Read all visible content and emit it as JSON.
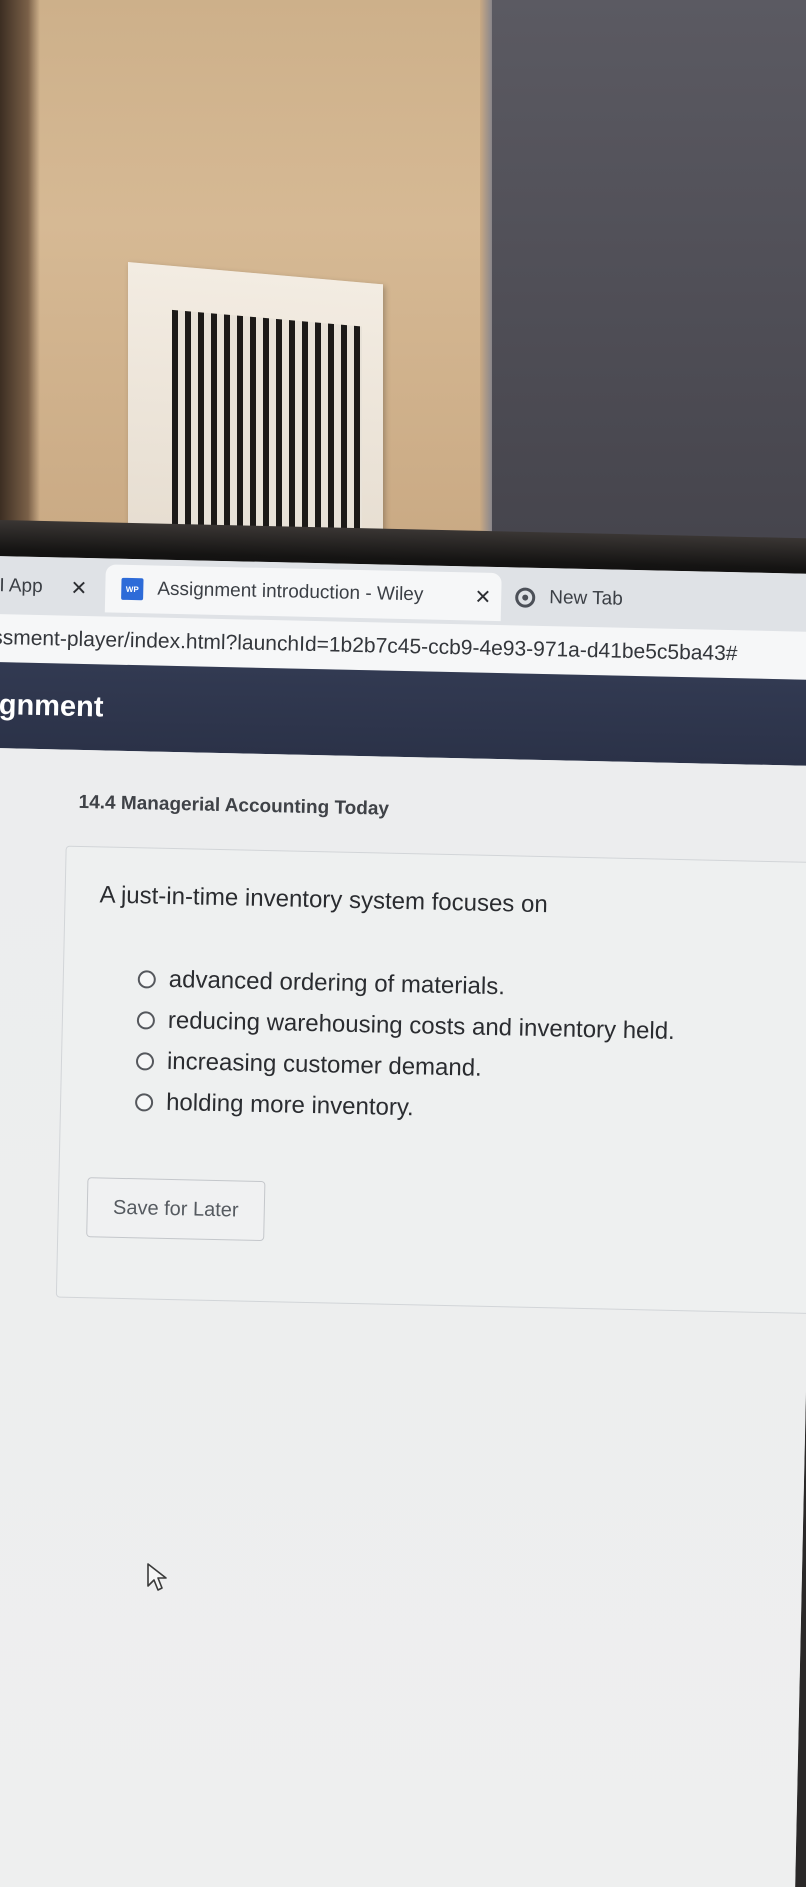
{
  "browser": {
    "tabs": [
      {
        "label": "I App",
        "close": "✕",
        "favicon": "app-icon",
        "active": false
      },
      {
        "label": "Assignment introduction - Wiley",
        "close": "✕",
        "favicon": "wileyplus-icon",
        "active": true
      },
      {
        "label": "New Tab",
        "close": "",
        "favicon": "chrome-icon",
        "active": false
      }
    ],
    "favicon_wp_text": "WP",
    "url": "ssment-player/index.html?launchId=1b2b7c45-ccb9-4e93-971a-d41be5c5ba43#"
  },
  "app": {
    "header_title": "ignment",
    "header_color": "#2f3750"
  },
  "question": {
    "section": "14.4 Managerial Accounting Today",
    "prompt": "A just-in-time inventory system focuses on",
    "options": [
      {
        "label": "advanced ordering of materials.",
        "selected": false
      },
      {
        "label": "reducing warehousing costs and inventory held.",
        "selected": false
      },
      {
        "label": "increasing customer demand.",
        "selected": false
      },
      {
        "label": "holding more inventory.",
        "selected": false
      }
    ],
    "save_label": "Save for Later"
  },
  "cursor": {
    "icon": "arrow-cursor-icon"
  }
}
